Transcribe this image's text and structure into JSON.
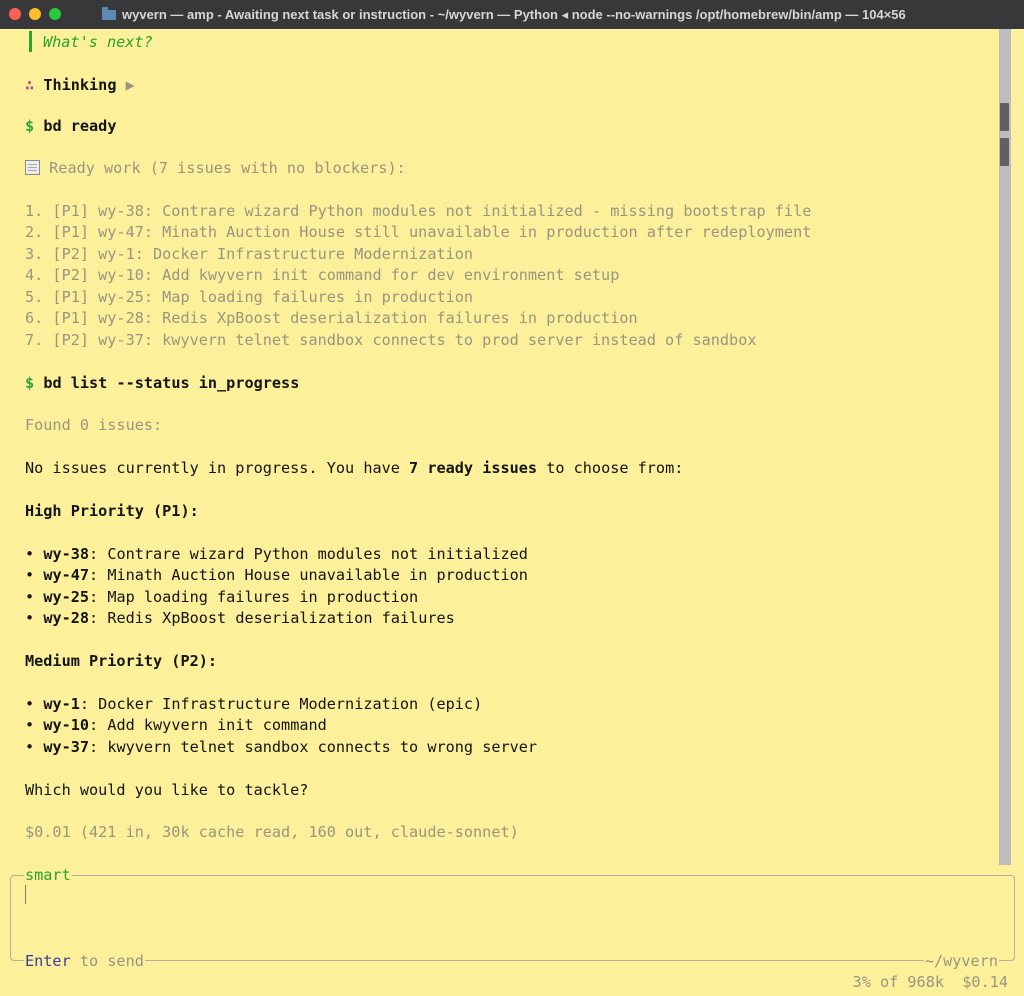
{
  "window": {
    "title": "wyvern — amp - Awaiting next task or instruction - ~/wyvern — Python ◂ node --no-warnings /opt/homebrew/bin/amp — 104×56",
    "folder_icon": "folder-icon"
  },
  "terminal": {
    "prev_prompt": "What's next?",
    "thinking": {
      "symbol": "∴",
      "label": "Thinking",
      "arrow": "▶"
    },
    "cmd1": {
      "prompt": "$",
      "text": "bd ready"
    },
    "ready_header": "Ready work (7 issues with no blockers):",
    "ready_items": [
      "1. [P1] wy-38: Contrare wizard Python modules not initialized - missing bootstrap file",
      "2. [P1] wy-47: Minath Auction House still unavailable in production after redeployment",
      "3. [P2] wy-1: Docker Infrastructure Modernization",
      "4. [P2] wy-10: Add kwyvern init command for dev environment setup",
      "5. [P1] wy-25: Map loading failures in production",
      "6. [P1] wy-28: Redis XpBoost deserialization failures in production",
      "7. [P2] wy-37: kwyvern telnet sandbox connects to prod server instead of sandbox"
    ],
    "cmd2": {
      "prompt": "$",
      "text": "bd list --status in_progress"
    },
    "found": "Found 0 issues:",
    "summary": {
      "pre": "No issues currently in progress. You have ",
      "bold": "7 ready issues",
      "post": " to choose from:"
    },
    "high_header": "High Priority (P1):",
    "high_items": [
      {
        "bullet": "•",
        "id": "wy-38",
        "text": ": Contrare wizard Python modules not initialized"
      },
      {
        "bullet": "•",
        "id": "wy-47",
        "text": ": Minath Auction House unavailable in production"
      },
      {
        "bullet": "•",
        "id": "wy-25",
        "text": ": Map loading failures in production"
      },
      {
        "bullet": "•",
        "id": "wy-28",
        "text": ": Redis XpBoost deserialization failures"
      }
    ],
    "medium_header": "Medium Priority (P2):",
    "medium_items": [
      {
        "bullet": "•",
        "id": "wy-1",
        "text": ": Docker Infrastructure Modernization (epic)"
      },
      {
        "bullet": "•",
        "id": "wy-10",
        "text": ": Add kwyvern init command"
      },
      {
        "bullet": "•",
        "id": "wy-37",
        "text": ": kwyvern telnet sandbox connects to wrong server"
      }
    ],
    "question": "Which would you like to tackle?",
    "cost_line": "$0.01 (421 in, 30k cache read, 160 out, claude-sonnet)"
  },
  "input": {
    "mode": "smart",
    "enter_key": "Enter",
    "send_hint": " to send",
    "cwd": "~/wyvern",
    "usage": "3% of 968k",
    "cost": "$0.14"
  },
  "colors": {
    "background": "#fcf09a",
    "prompt_green": "#2fa52f",
    "dim_gray": "#9a9580",
    "titlebar": "#38383a"
  }
}
